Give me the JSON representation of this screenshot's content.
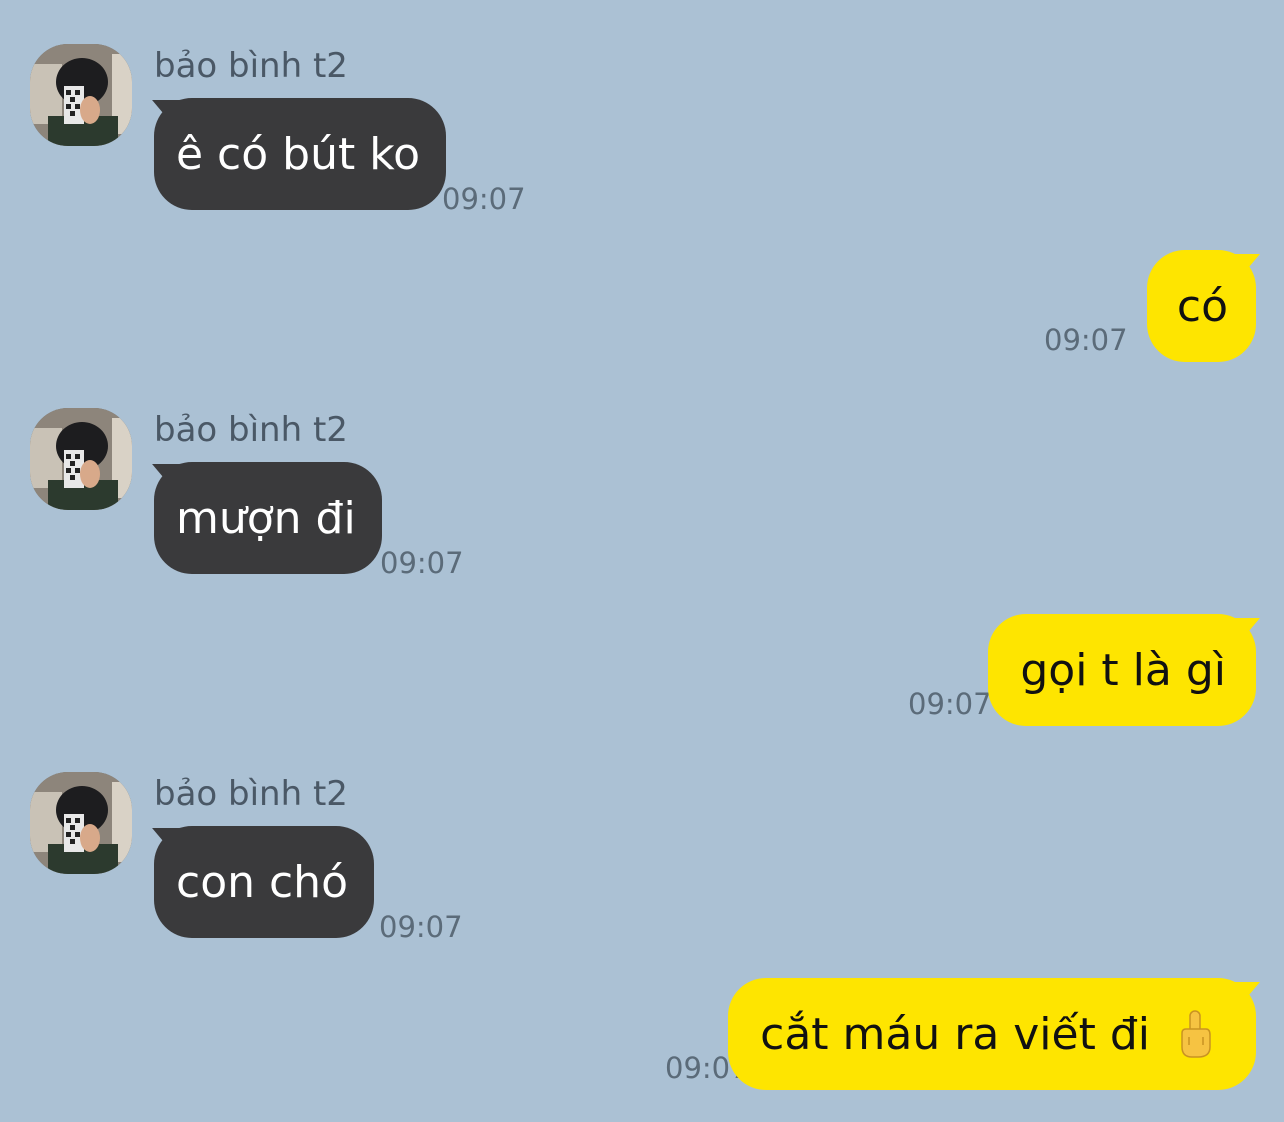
{
  "messages": [
    {
      "direction": "incoming",
      "sender": "bảo bình t2",
      "text": "ê có bút ko",
      "time": "09:07"
    },
    {
      "direction": "outgoing",
      "text": "có",
      "time": "09:07"
    },
    {
      "direction": "incoming",
      "sender": "bảo bình t2",
      "text": "mượn đi",
      "time": "09:07"
    },
    {
      "direction": "outgoing",
      "text": "gọi t là gì",
      "time": "09:07"
    },
    {
      "direction": "incoming",
      "sender": "bảo bình t2",
      "text": "con chó",
      "time": "09:07"
    },
    {
      "direction": "outgoing",
      "text": "cắt máu ra viết đi",
      "emoji": "middle-finger",
      "time": "09:07"
    }
  ],
  "colors": {
    "background": "#abc1d4",
    "incoming_bubble": "#3a3a3c",
    "outgoing_bubble": "#fee500"
  }
}
